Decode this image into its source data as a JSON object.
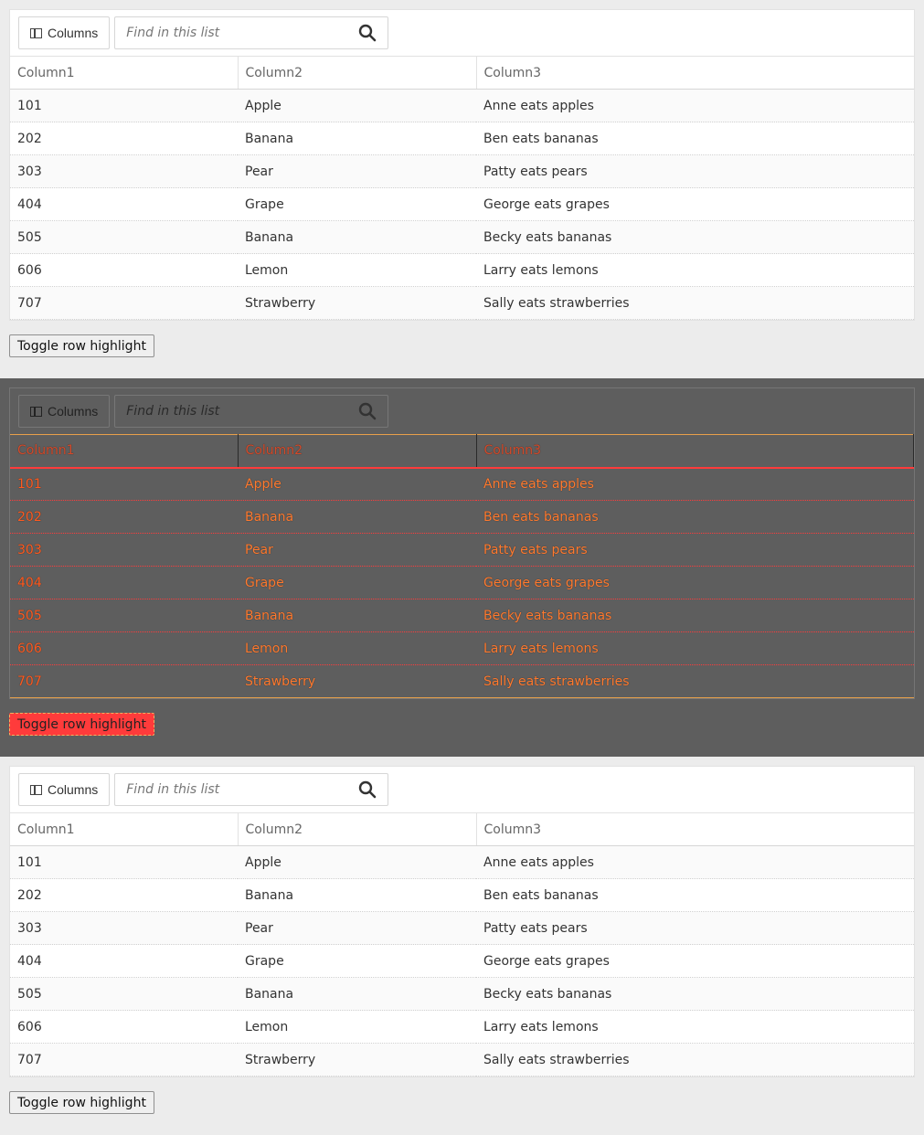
{
  "toolbar": {
    "columns_label": "Columns",
    "search_placeholder": "Find in this list"
  },
  "table": {
    "headers": [
      "Column1",
      "Column2",
      "Column3"
    ],
    "rows": [
      [
        "101",
        "Apple",
        "Anne eats apples"
      ],
      [
        "202",
        "Banana",
        "Ben eats bananas"
      ],
      [
        "303",
        "Pear",
        "Patty eats pears"
      ],
      [
        "404",
        "Grape",
        "George eats grapes"
      ],
      [
        "505",
        "Banana",
        "Becky eats bananas"
      ],
      [
        "606",
        "Lemon",
        "Larry eats lemons"
      ],
      [
        "707",
        "Strawberry",
        "Sally eats strawberries"
      ]
    ]
  },
  "toggle_label": "Toggle row highlight",
  "colors": {
    "page_bg": "#ececec",
    "hc_bg": "#5e5e5e",
    "hc_accent": "#ff3b3b"
  },
  "icons": [
    "columns-icon",
    "search-icon"
  ]
}
